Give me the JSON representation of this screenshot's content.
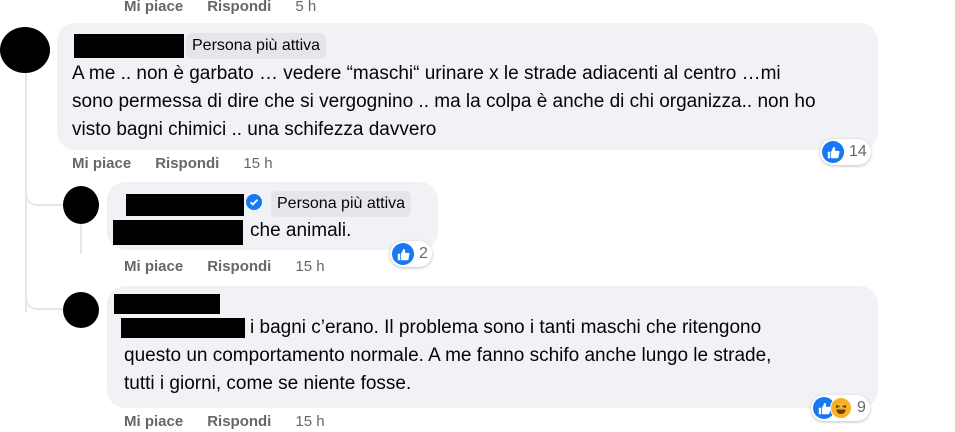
{
  "top_actions": {
    "like": "Mi piace",
    "reply": "Rispondi",
    "time": "5 h"
  },
  "comments": [
    {
      "badge": "Persona più attiva",
      "text_lines": [
        "A me .. non è garbato … vedere “maschi“ urinare x le strade adiacenti al centro …mi",
        "sono permessa di dire che si vergognino .. ma la colpa è anche di chi organizza.. non ho",
        "visto bagni chimici .. una schifezza davvero"
      ],
      "reaction_count": "14",
      "actions": {
        "like": "Mi piace",
        "reply": "Rispondi",
        "time": "15 h"
      }
    },
    {
      "badge": "Persona più attiva",
      "text": "che animali.",
      "reaction_count": "2",
      "actions": {
        "like": "Mi piace",
        "reply": "Rispondi",
        "time": "15 h"
      }
    },
    {
      "text_lines": [
        "i bagni c’erano. Il problema sono i tanti maschi che ritengono",
        "questo un comportamento normale. A me fanno schifo anche lungo le strade,",
        "tutti i giorni, come se niente fosse."
      ],
      "reaction_count": "9",
      "actions": {
        "like": "Mi piace",
        "reply": "Rispondi",
        "time": "15 h"
      }
    }
  ],
  "colors": {
    "like": "#1877f2",
    "haha": "#f7b125",
    "bubble": "#f0f2f5",
    "verified": "#1877f2"
  },
  "icons": [
    "like-reaction-icon",
    "haha-reaction-icon",
    "verified-badge-icon"
  ]
}
